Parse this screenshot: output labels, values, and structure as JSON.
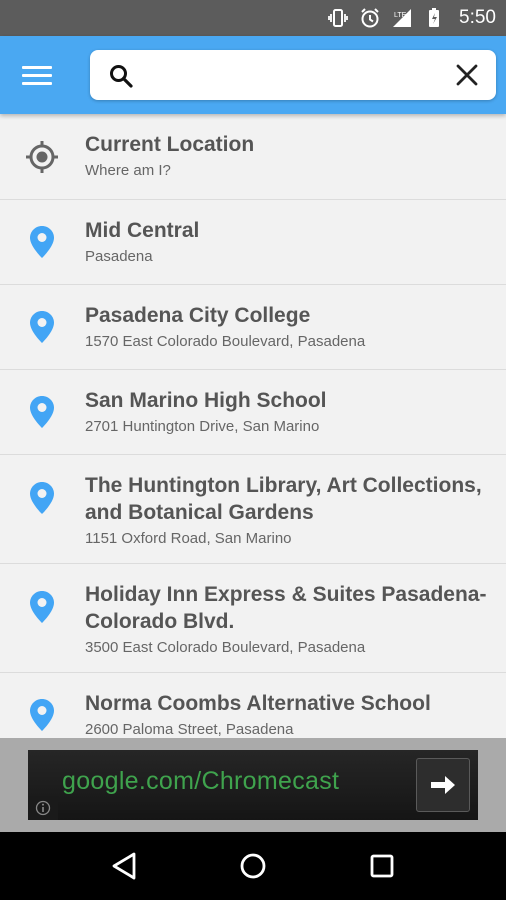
{
  "status_bar": {
    "time": "5:50",
    "icons": [
      "vibrate-icon",
      "alarm-icon",
      "signal-icon",
      "battery-icon"
    ]
  },
  "toolbar": {
    "menu_icon": "hamburger-menu-icon",
    "search": {
      "value": "",
      "placeholder": ""
    },
    "clear_icon": "close-icon"
  },
  "results": [
    {
      "icon": "current-location-icon",
      "title": "Current Location",
      "subtitle": "Where am I?"
    },
    {
      "icon": "place-pin-icon",
      "title": "Mid Central",
      "subtitle": "Pasadena"
    },
    {
      "icon": "place-pin-icon",
      "title": "Pasadena City College",
      "subtitle": "1570 East Colorado Boulevard, Pasadena"
    },
    {
      "icon": "place-pin-icon",
      "title": "San Marino High School",
      "subtitle": "2701 Huntington Drive, San Marino"
    },
    {
      "icon": "place-pin-icon",
      "title": "The Huntington Library, Art Collections, and Botanical Gardens",
      "subtitle": "1151 Oxford Road, San Marino"
    },
    {
      "icon": "place-pin-icon",
      "title": "Holiday Inn Express & Suites Pasadena-Colorado Blvd.",
      "subtitle": "3500 East Colorado Boulevard, Pasadena"
    },
    {
      "icon": "place-pin-icon",
      "title": "Norma Coombs Alternative School",
      "subtitle": "2600 Paloma Street, Pasadena"
    }
  ],
  "ad": {
    "text": "google.com/Chromecast",
    "arrow_icon": "arrow-right-icon",
    "info_icon": "info-icon"
  },
  "nav_bar": {
    "icons": [
      "back-icon",
      "home-icon",
      "recents-icon"
    ]
  },
  "colors": {
    "accent": "#4aa8f2",
    "pin": "#42a5f5",
    "status_bar": "#5c5c5c",
    "ad_text": "#3fa34d"
  }
}
